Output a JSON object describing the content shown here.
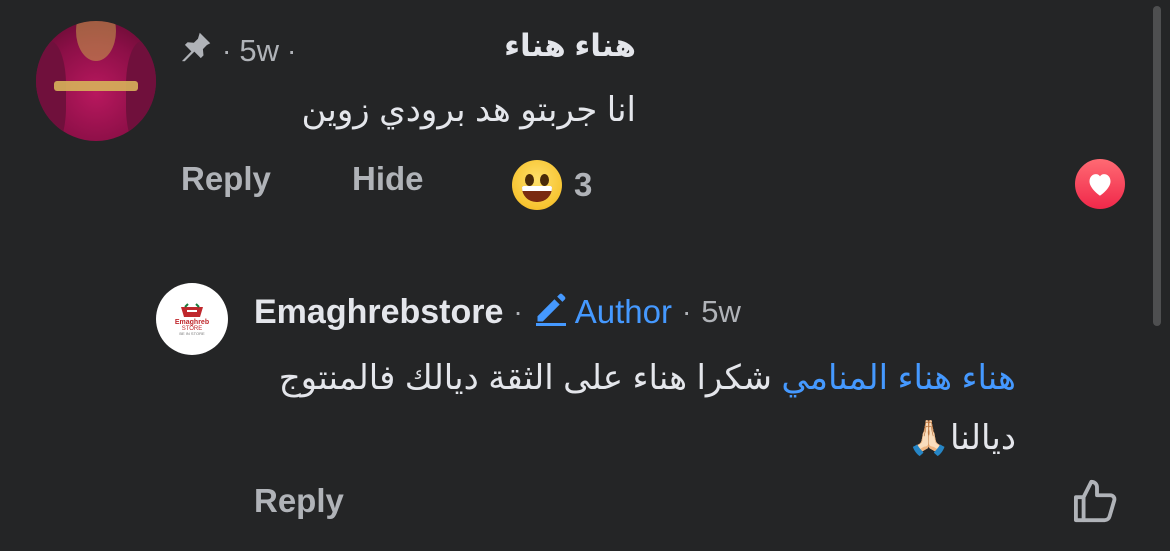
{
  "comment": {
    "time": "5w",
    "name": "هناء  هناء",
    "text": "انا جربتو  هد برودي  زوين",
    "actions": {
      "reply": "Reply",
      "hide": "Hide"
    },
    "reaction_count": "3",
    "icons": {
      "pin": "pin-icon",
      "reaction": "grinning-emoji-icon",
      "badge": "heart-reaction-icon"
    }
  },
  "reply": {
    "name": "Emaghrebstore",
    "author_label": "Author",
    "time": "5w",
    "mention": "هناء هناء المنامي",
    "text": " شكرا هناء على الثقة ديالك فالمنتوج ديالنا",
    "emoji": "🙏🏻",
    "avatar_text": {
      "line1": "Emaghreb",
      "line2": "STORE",
      "line3": "BE IN STORE"
    },
    "actions": {
      "reply": "Reply"
    },
    "icons": {
      "edit": "pencil-icon",
      "like": "thumbs-up-icon"
    }
  },
  "colors": {
    "background": "#242526",
    "link": "#4599ff",
    "secondary_text": "#b0b3b8",
    "heart": "#f0284a"
  }
}
